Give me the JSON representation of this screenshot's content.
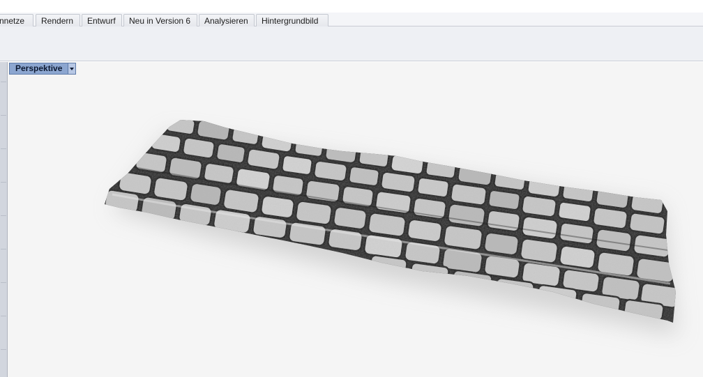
{
  "ribbon": {
    "tabs": [
      {
        "label": "nnetze"
      },
      {
        "label": "Rendern"
      },
      {
        "label": "Entwurf"
      },
      {
        "label": "Neu in Version 6"
      },
      {
        "label": "Analysieren"
      },
      {
        "label": "Hintergrundbild"
      }
    ]
  },
  "viewport": {
    "title": "Perspektive",
    "menu_icon": "chevron-down-icon",
    "model_icon": "cobblestone-surface-render"
  },
  "colors": {
    "viewport_tab": "#8ca6d0",
    "viewport_background": "#f5f5f5",
    "ribbon_background": "#eef0f4"
  }
}
